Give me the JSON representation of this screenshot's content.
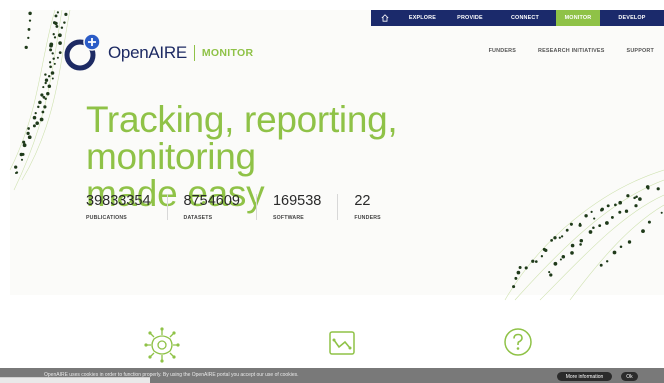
{
  "topnav": {
    "items": [
      {
        "label": "EXPLORE",
        "active": false
      },
      {
        "label": "PROVIDE",
        "active": false
      },
      {
        "label": "CONNECT",
        "active": false
      },
      {
        "label": "MONITOR",
        "active": true
      },
      {
        "label": "DEVELOP",
        "active": false
      }
    ]
  },
  "logo": {
    "name": "OpenAIRE",
    "product": "MONITOR"
  },
  "subnav": {
    "items": [
      "FUNDERS",
      "RESEARCH INITIATIVES",
      "SUPPORT"
    ]
  },
  "hero": {
    "headline_line1": "Tracking, reporting, monitoring",
    "headline_line2": "made easy"
  },
  "stats": [
    {
      "value": "39833354",
      "label": "PUBLICATIONS"
    },
    {
      "value": "8754609",
      "label": "DATASETS"
    },
    {
      "value": "169538",
      "label": "SOFTWARE"
    },
    {
      "value": "22",
      "label": "FUNDERS"
    }
  ],
  "features": [
    {
      "icon": "network-gear-icon"
    },
    {
      "icon": "chart-monitor-icon"
    },
    {
      "icon": "help-circle-icon"
    }
  ],
  "cookie_bar": {
    "text": "OpenAIRE uses cookies in order to function properly. By using the OpenAIRE portal you accept our use of cookies.",
    "more_label": "More information",
    "ok_label": "Ok"
  },
  "colors": {
    "brand_navy": "#1b2a6b",
    "brand_green": "#8fc247",
    "cookie_bg": "#797979"
  }
}
